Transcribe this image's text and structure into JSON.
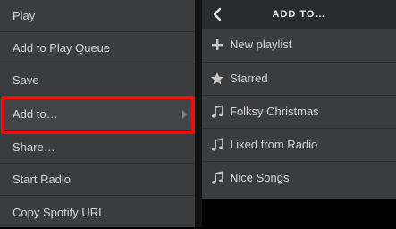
{
  "context_menu": {
    "items": [
      {
        "label": "Play"
      },
      {
        "label": "Add to Play Queue"
      },
      {
        "label": "Save"
      },
      {
        "label": "Add to…"
      },
      {
        "label": "Share…"
      },
      {
        "label": "Start Radio"
      },
      {
        "label": "Copy Spotify URL"
      }
    ],
    "highlight_color": "#f00d0d"
  },
  "submenu": {
    "title": "ADD TO…",
    "back_icon": "chevron-left-icon",
    "items": [
      {
        "label": "New playlist",
        "icon": "plus-icon"
      },
      {
        "label": "Starred",
        "icon": "star-icon"
      },
      {
        "label": "Folksy Christmas",
        "icon": "music-note-icon"
      },
      {
        "label": "Liked from Radio",
        "icon": "music-note-icon"
      },
      {
        "label": "Nice Songs",
        "icon": "music-note-icon"
      }
    ]
  }
}
